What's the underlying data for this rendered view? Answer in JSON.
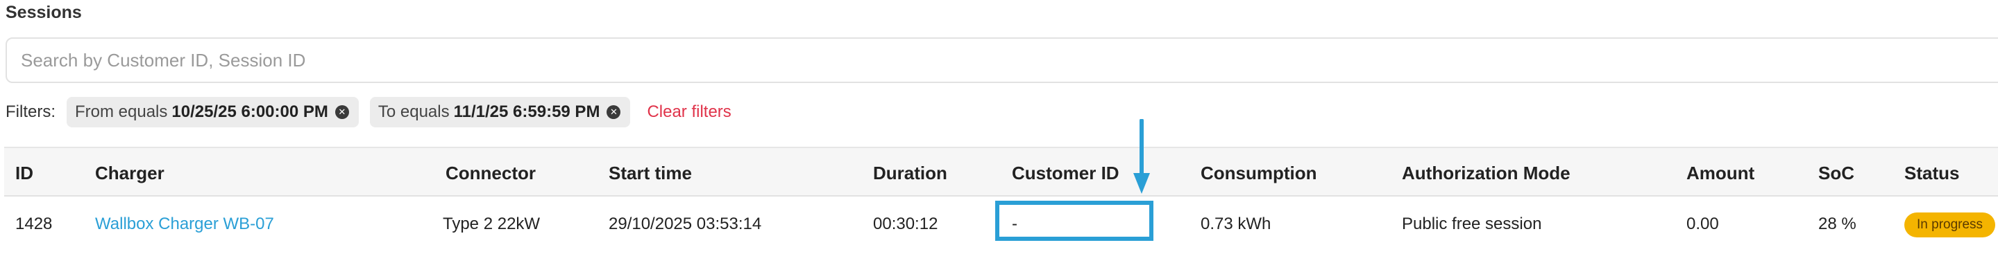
{
  "page": {
    "title": "Sessions"
  },
  "search": {
    "placeholder": "Search by Customer ID, Session ID",
    "value": ""
  },
  "filters": {
    "label": "Filters:",
    "chips": [
      {
        "prefix": "From equals",
        "value": "10/25/25 6:00:00 PM"
      },
      {
        "prefix": "To equals",
        "value": "11/1/25 6:59:59 PM"
      }
    ],
    "clear_label": "Clear filters"
  },
  "table": {
    "columns": [
      "ID",
      "Charger",
      "Connector",
      "Start time",
      "Duration",
      "Customer ID",
      "Consumption",
      "Authorization Mode",
      "Amount",
      "SoC",
      "Status"
    ],
    "rows": [
      {
        "id": "1428",
        "charger": "Wallbox Charger WB-07",
        "connector": "Type 2 22kW",
        "start_time": "29/10/2025 03:53:14",
        "duration": "00:30:12",
        "customer_id": "-",
        "consumption": "0.73 kWh",
        "authorization_mode": "Public free session",
        "amount": "0.00",
        "soc": "28 %",
        "status": "In progress"
      }
    ]
  },
  "colors": {
    "link": "#2a9fd6",
    "highlight": "#2a9fd6",
    "clear_filters": "#e0334a",
    "status_badge": "#f4b400"
  }
}
